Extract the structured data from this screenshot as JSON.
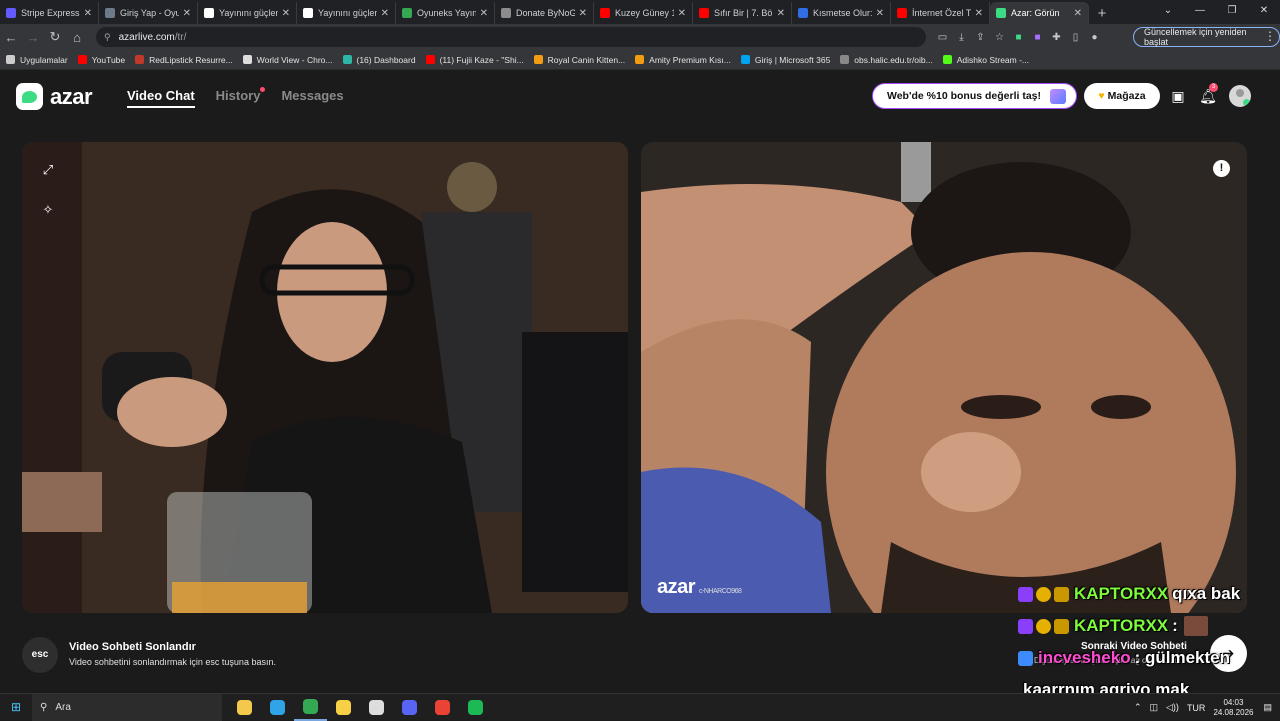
{
  "browser": {
    "tabs": [
      {
        "label": "Stripe Express",
        "color": "#635bff"
      },
      {
        "label": "Giriş Yap - Oyun",
        "color": "#6c7a89"
      },
      {
        "label": "Yayınını güçlend",
        "color": "#ffffff"
      },
      {
        "label": "Yayınını güçlend",
        "color": "#ffffff"
      },
      {
        "label": "Oyuneks Yayıncı",
        "color": "#34a853"
      },
      {
        "label": "Donate ByNoGa",
        "color": "#8c8c8c"
      },
      {
        "label": "Kuzey Güney 1.",
        "color": "#ff0000"
      },
      {
        "label": "Sıfır Bir | 7. Bölü",
        "color": "#ff0000"
      },
      {
        "label": "Kısmetse Olur: A",
        "color": "#2f6ee4"
      },
      {
        "label": "İnternet Özel Tu",
        "color": "#ff0000"
      },
      {
        "label": "Azar: Görün",
        "color": "#3ddc84"
      }
    ],
    "url_domain": "azarlive.com",
    "url_path": "/tr/",
    "update_button": "Güncellemek için yeniden başlat",
    "bookmarks": [
      {
        "label": "Uygulamalar",
        "color": "#cccccc"
      },
      {
        "label": "YouTube",
        "color": "#ff0000"
      },
      {
        "label": "RedLipstick Resurre...",
        "color": "#c0392b"
      },
      {
        "label": "World View - Chro...",
        "color": "#dddddd"
      },
      {
        "label": "(16) Dashboard",
        "color": "#2fb5a6"
      },
      {
        "label": "(11) Fujii Kaze - \"Shi...",
        "color": "#ff0000"
      },
      {
        "label": "Royal Canin Kitten...",
        "color": "#f39c12"
      },
      {
        "label": "Amity Premium Kısı...",
        "color": "#f39c12"
      },
      {
        "label": "Giriş | Microsoft 365",
        "color": "#00a4ef"
      },
      {
        "label": "obs.halic.edu.tr/oib...",
        "color": "#888888"
      },
      {
        "label": "Adishko Stream -...",
        "color": "#53fc18"
      }
    ]
  },
  "azar": {
    "logo_text": "azar",
    "nav": {
      "video_chat": "Video Chat",
      "history": "History",
      "messages": "Messages"
    },
    "promo_label": "Web'de %10 bonus değerli taş!",
    "store_label": "Mağaza",
    "notification_count": "3",
    "watermark": "azar",
    "watermark_id": "c-NHARCO968",
    "end_title": "Video Sohbeti Sonlandır",
    "end_subtitle": "Video sohbetini sonlandırmak için esc tuşuna basın.",
    "esc_key": "esc",
    "next_title": "Sonraki Video Sohbeti",
    "next_subtitle": "Diğerleriyle buluşmak için sağ oka basın"
  },
  "stream_chat": [
    {
      "user": "KAPTORXX",
      "message": "qıxa bak",
      "icons": [
        "purple",
        "gold",
        "crown"
      ]
    },
    {
      "user": "KAPTORXX",
      "message": ":",
      "icons": [
        "purple",
        "gold",
        "crown"
      ],
      "emote": true
    },
    {
      "user": "incvesheko",
      "message": ": gülmekten",
      "icons": [
        "blue"
      ]
    },
    {
      "user": "",
      "message": "kaarrnım agriyo mak",
      "icons": []
    }
  ],
  "taskbar": {
    "search_placeholder": "Ara",
    "language": "TUR",
    "time": "04:03",
    "date": "24.08.2026",
    "apps": [
      {
        "name": "file-explorer",
        "color": "#f2c94c"
      },
      {
        "name": "edge",
        "color": "#2fa4e7"
      },
      {
        "name": "chrome",
        "color": "#34a853"
      },
      {
        "name": "notes",
        "color": "#f7d046"
      },
      {
        "name": "obs",
        "color": "#dddddd"
      },
      {
        "name": "discord",
        "color": "#5865f2"
      },
      {
        "name": "chrome-profile",
        "color": "#ea4335"
      },
      {
        "name": "spotify",
        "color": "#1db954"
      }
    ]
  }
}
